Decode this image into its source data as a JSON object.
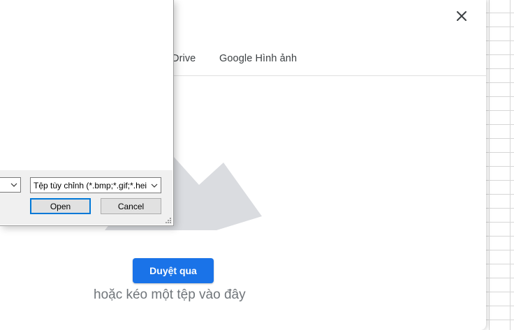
{
  "picker": {
    "close_icon": "close-icon",
    "tabs": [
      {
        "label": "Drive"
      },
      {
        "label": "Google Hình ảnh"
      }
    ],
    "browse_label": "Duyệt qua",
    "drag_text": "hoặc kéo một tệp vào đây"
  },
  "file_dialog": {
    "filter_value": "Tệp tùy chỉnh (*.bmp;*.gif;*.hei",
    "open_label": "Open",
    "cancel_label": "Cancel"
  },
  "colors": {
    "accent": "#1a73e8",
    "tab_text": "#3c4043",
    "muted_text": "#70757a",
    "focus_border": "#0078d7"
  }
}
